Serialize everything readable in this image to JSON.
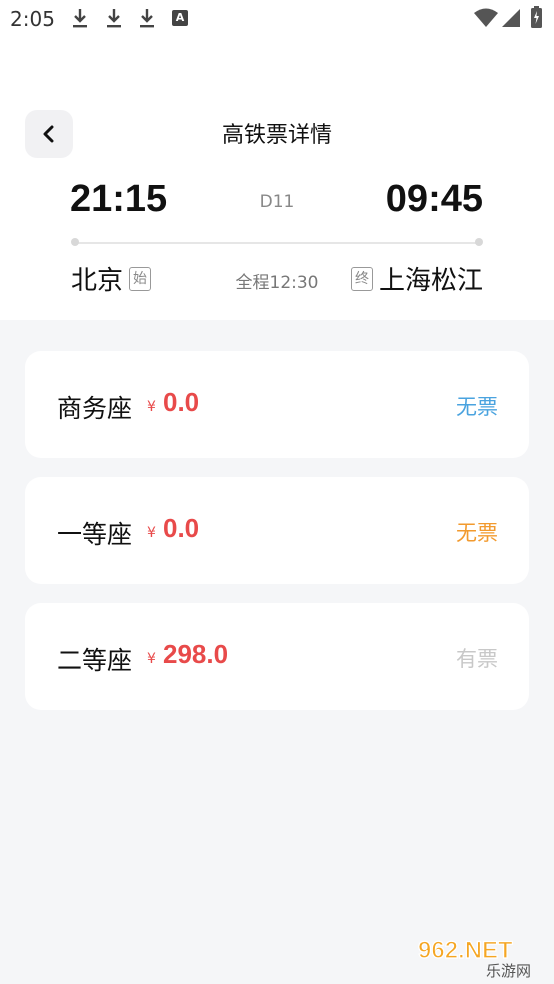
{
  "status_bar": {
    "time": "2:05",
    "icons": [
      "download-icon",
      "download-icon",
      "download-icon",
      "a-icon",
      "wifi-icon",
      "signal-icon",
      "battery-icon"
    ],
    "a_label": "A"
  },
  "header": {
    "title": "高铁票详情",
    "back_icon": "chevron-left-icon"
  },
  "trip": {
    "departure_time": "21:15",
    "arrival_time": "09:45",
    "train_number": "D11",
    "origin": "北京",
    "origin_tag": "始",
    "destination": "上海松江",
    "destination_tag": "终",
    "duration": "全程12:30"
  },
  "seats": [
    {
      "name": "商务座",
      "currency": "¥",
      "price": "0.0",
      "availability": "无票",
      "availability_color": "#4aa3df"
    },
    {
      "name": "一等座",
      "currency": "¥",
      "price": "0.0",
      "availability": "无票",
      "availability_color": "#f29a2e"
    },
    {
      "name": "二等座",
      "currency": "¥",
      "price": "298.0",
      "availability": "有票",
      "availability_color": "#c8c8c8"
    }
  ],
  "colors": {
    "price": "#e84a4a",
    "background": "#f5f6f8",
    "card": "#ffffff"
  },
  "watermark": {
    "text": "962.NET",
    "subtext": "乐游网"
  }
}
